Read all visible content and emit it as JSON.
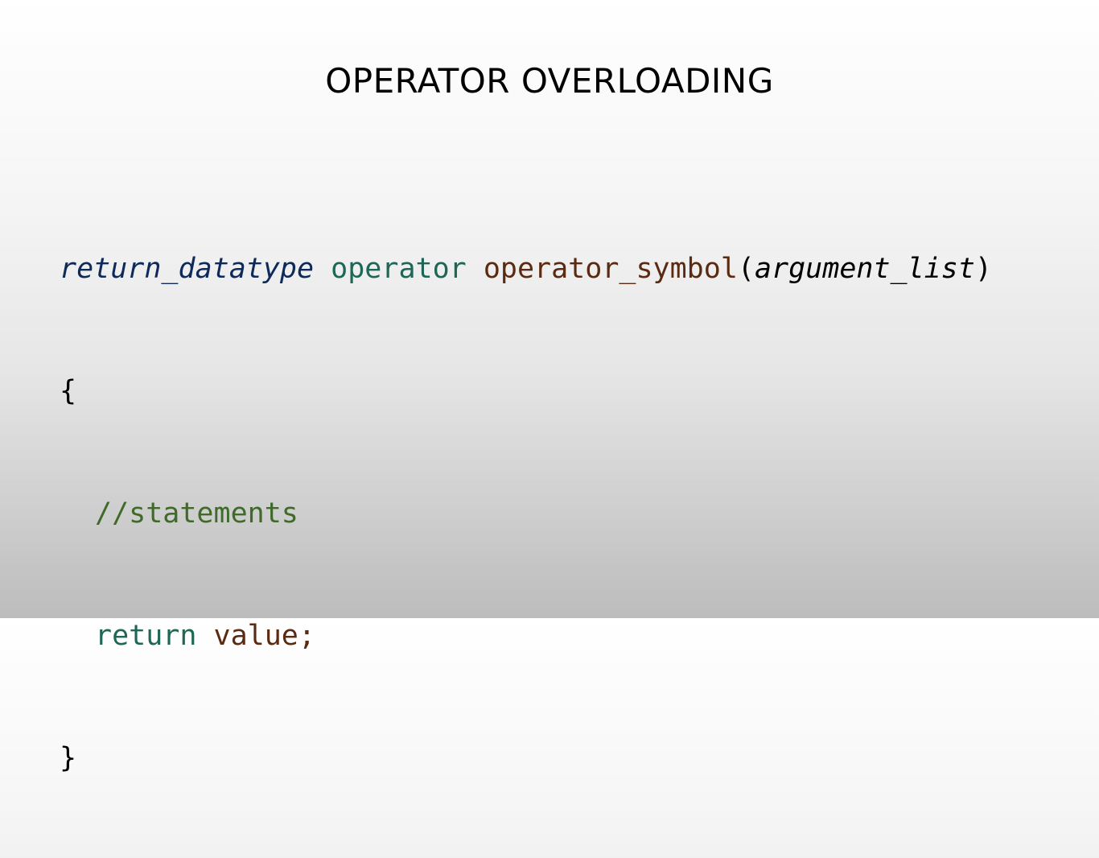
{
  "slide": {
    "title": "OPERATOR OVERLOADING"
  },
  "code": {
    "line1": {
      "return_type": "return_datatype",
      "keyword": "operator",
      "symbol": "operator_symbol",
      "open_paren": "(",
      "argument": "argument_list",
      "close_paren": ")"
    },
    "open_brace": "{",
    "comment": "//statements",
    "return_keyword": "return",
    "return_value": "value;",
    "close_brace": "}"
  },
  "colors": {
    "return_type": "#0e2a5a",
    "keyword": "#1e6655",
    "symbol": "#5a2a12",
    "comment": "#3f6a2a"
  }
}
